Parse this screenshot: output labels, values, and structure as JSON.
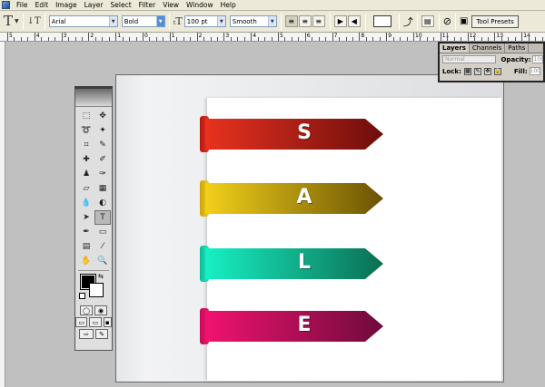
{
  "menu": {
    "items": [
      "File",
      "Edit",
      "Image",
      "Layer",
      "Select",
      "Filter",
      "View",
      "Window",
      "Help"
    ]
  },
  "options": {
    "font_family": "Arial",
    "font_style": "Bold",
    "font_size": "100 pt",
    "antialias": "Smooth",
    "tool_presets": "Tool Presets"
  },
  "ruler": {
    "labels": [
      "5",
      "4",
      "3",
      "2",
      "1",
      "0",
      "1",
      "2",
      "3",
      "4",
      "5",
      "6",
      "7",
      "8",
      "9",
      "10",
      "11",
      "12",
      "13",
      "14"
    ]
  },
  "layers_panel": {
    "tabs": [
      "Layers",
      "Channels",
      "Paths"
    ],
    "blend_mode": "Normal",
    "opacity_label": "Opacity:",
    "opacity_value": "100",
    "lock_label": "Lock:",
    "fill_label": "Fill:",
    "fill_value": "100"
  },
  "artwork": {
    "banners": [
      {
        "letter": "S",
        "color_start": "#e8321f",
        "color_end": "#6e0d0c",
        "fold": "#b01a10"
      },
      {
        "letter": "A",
        "color_start": "#f2d01a",
        "color_end": "#6a5204",
        "fold": "#c9a311"
      },
      {
        "letter": "L",
        "color_start": "#17f0c4",
        "color_end": "#0b6e52",
        "fold": "#12b892"
      },
      {
        "letter": "E",
        "color_start": "#f0136f",
        "color_end": "#6e0a3c",
        "fold": "#c10d57"
      }
    ]
  }
}
